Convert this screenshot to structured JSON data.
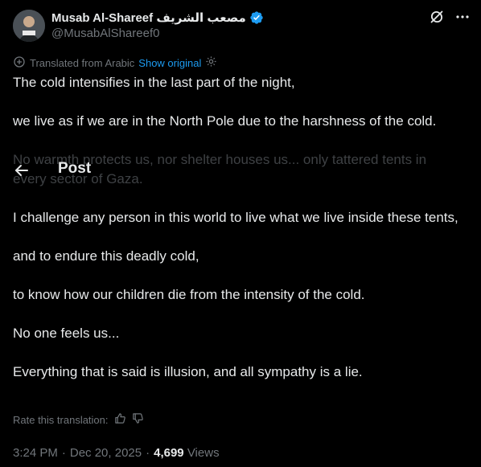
{
  "author": {
    "display_name": "Musab Al-Shareef مصعب الشريف",
    "handle": "@MusabAlShareef0",
    "verified": true
  },
  "top_actions": {
    "grok_icon": "grok-icon",
    "more_icon": "more-icon"
  },
  "translation": {
    "notice": "Translated from Arabic",
    "show_original": "Show original"
  },
  "header": {
    "title": "Post",
    "back_icon": "back-arrow-icon"
  },
  "tweet": {
    "paragraphs": [
      "The cold intensifies in the last part of the night,",
      "we live as if we are in the North Pole due to the harshness of the cold.",
      "No warmth protects us, nor shelter houses us... only tattered tents in every sector of Gaza.",
      "I challenge any person in this world to live what we live inside these tents,",
      "and to endure this deadly cold,",
      "to know how our children die from the intensity of the cold.",
      "No one feels us...",
      "Everything that is said is illusion, and all sympathy is a lie."
    ]
  },
  "rate": {
    "label": "Rate this translation:"
  },
  "meta": {
    "time": "3:24 PM",
    "separator": "·",
    "date": "Dec 20, 2025",
    "views_count": "4,699",
    "views_label": "Views"
  },
  "colors": {
    "background": "#000000",
    "text": "#e7e9ea",
    "muted": "#71767b",
    "accent": "#1d9bf0",
    "faded_text": "#3e4144"
  }
}
